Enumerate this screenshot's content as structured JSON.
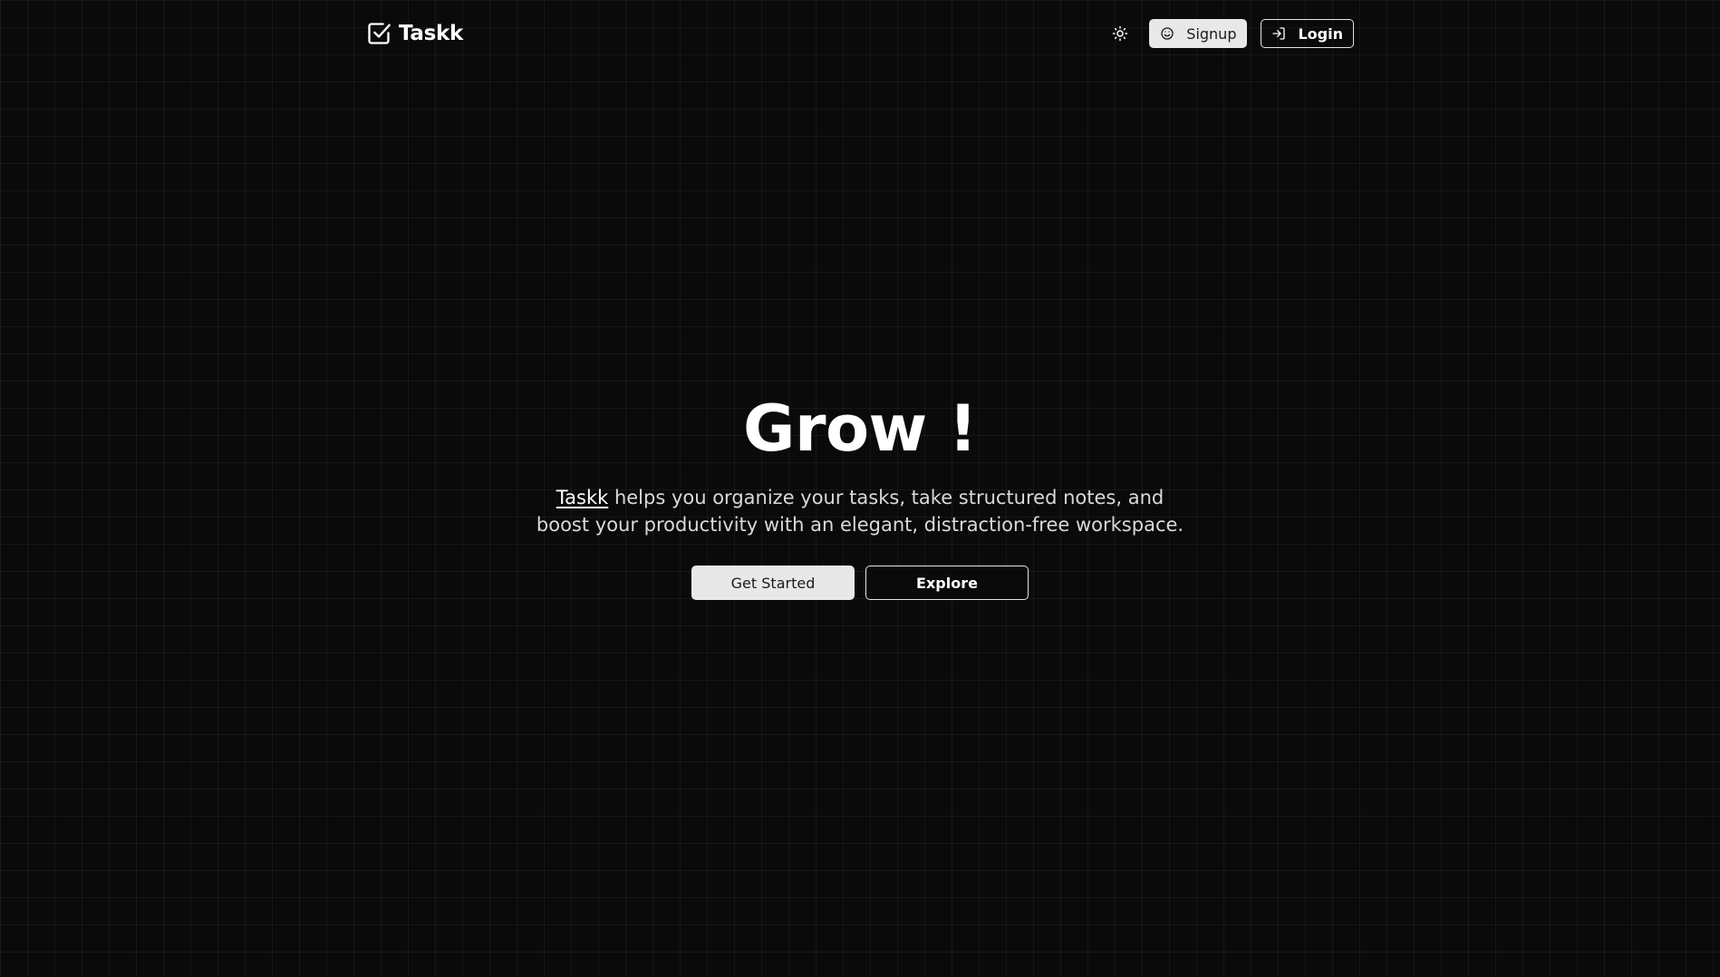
{
  "brand": {
    "name": "Taskk",
    "icon": "check-square-icon"
  },
  "nav": {
    "theme_toggle_icon": "sun-icon",
    "signup": {
      "label": "Signup",
      "icon": "smile-icon"
    },
    "login": {
      "label": "Login",
      "icon": "log-in-icon"
    }
  },
  "hero": {
    "title": "Grow !",
    "subtitle_brand": "Taskk",
    "subtitle_rest": " helps you organize your tasks, take structured notes, and boost your productivity with an elegant, distraction-free workspace.",
    "primary_button": "Get Started",
    "secondary_button": "Explore"
  },
  "colors": {
    "background": "#0a0a0a",
    "grid_line": "#1c1c1c",
    "primary_button_bg": "#e8e8e8",
    "text": "#ffffff"
  }
}
